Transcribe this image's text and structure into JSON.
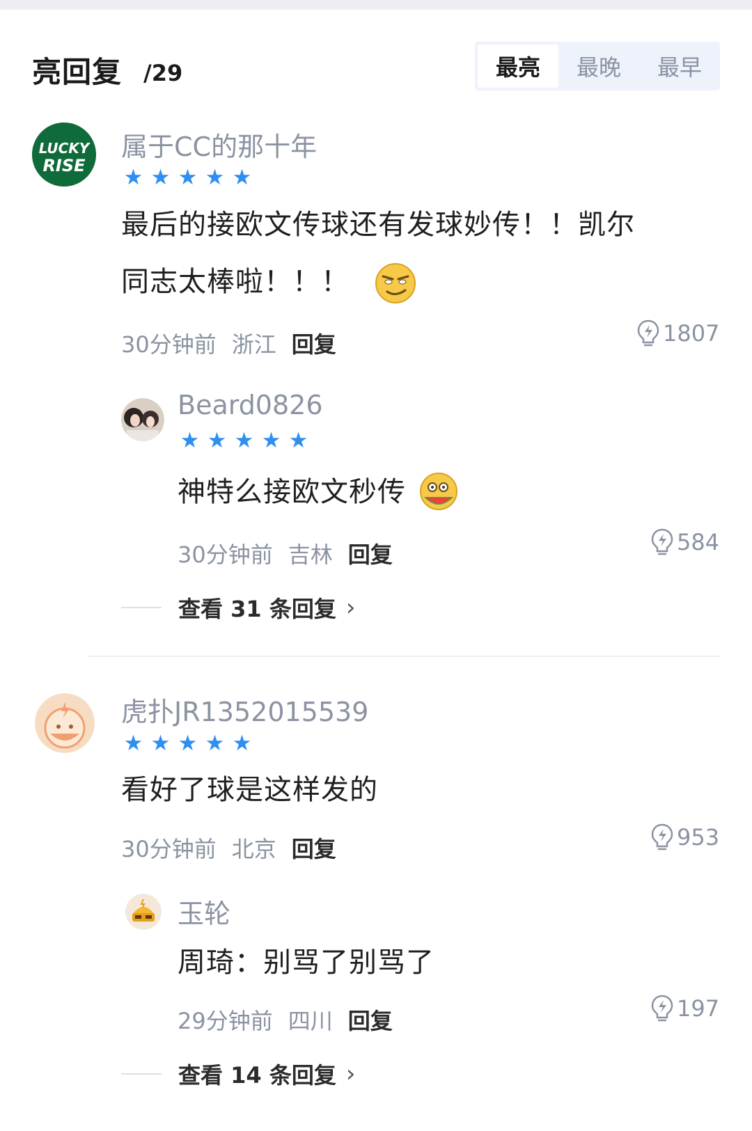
{
  "header": {
    "title": "亮回复",
    "count": "/29",
    "sort_tabs": [
      {
        "label": "最亮",
        "active": true
      },
      {
        "label": "最晚",
        "active": false
      },
      {
        "label": "最早",
        "active": false
      }
    ]
  },
  "comments": [
    {
      "username": "属于CC的那十年",
      "avatar_text_1": "LUCKY",
      "avatar_text_2": "RISE",
      "rating": 5,
      "content_line1": "最后的接欧文传球还有发球妙传！！凯尔",
      "content_line2": "同志太棒啦！！！",
      "time": "30分钟前",
      "location": "浙江",
      "reply_label": "回复",
      "light_count": "1807",
      "reply": {
        "username": "Beard0826",
        "rating": 5,
        "content": "神特么接欧文秒传",
        "time": "30分钟前",
        "location": "吉林",
        "reply_label": "回复",
        "light_count": "584"
      },
      "view_more": "查看 31 条回复"
    },
    {
      "username": "虎扑JR1352015539",
      "rating": 5,
      "content_line1": "看好了球是这样发的",
      "time": "30分钟前",
      "location": "北京",
      "reply_label": "回复",
      "light_count": "953",
      "reply": {
        "username": "玉轮",
        "content": "周琦：别骂了别骂了",
        "time": "29分钟前",
        "location": "四川",
        "reply_label": "回复",
        "light_count": "197"
      },
      "view_more": "查看 14 条回复"
    }
  ],
  "colors": {
    "star": "#2f8ff0",
    "muted": "#8a93a2",
    "tab_bg": "#eef2fa",
    "avatar_green": "#0f6b3a",
    "avatar_peach": "#f7dcc4"
  }
}
